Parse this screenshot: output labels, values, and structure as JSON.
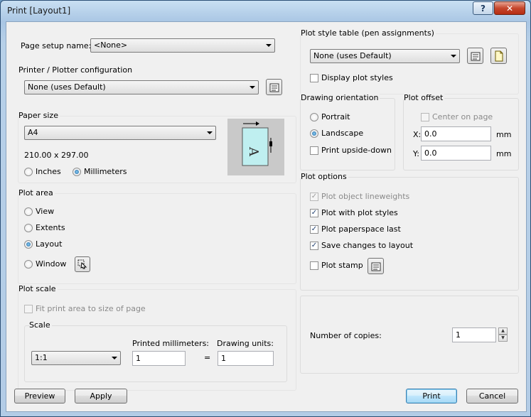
{
  "window": {
    "title": "Print [Layout1]",
    "help_label": "?",
    "close_label": "✕"
  },
  "page_setup": {
    "label": "Page setup name:",
    "value": "<None>"
  },
  "printer": {
    "group_title": "Printer / Plotter configuration",
    "value": "None (uses Default)"
  },
  "paper": {
    "group_title": "Paper size",
    "value": "A4",
    "dimensions": "210.00 x 297.00",
    "units": [
      "Inches",
      "Millimeters"
    ],
    "selected_unit": "Millimeters"
  },
  "plot_area": {
    "group_title": "Plot area",
    "options": [
      "View",
      "Extents",
      "Layout",
      "Window"
    ],
    "selected": "Layout"
  },
  "plot_scale": {
    "group_title": "Plot scale",
    "fit_label": "Fit print area to size of page",
    "scale_group_title": "Scale",
    "scale_value": "1:1",
    "printed_label": "Printed millimeters:",
    "printed_value": "1",
    "equals": "=",
    "drawing_label": "Drawing units:",
    "drawing_value": "1"
  },
  "plot_style": {
    "group_title": "Plot style table (pen assignments)",
    "value": "None (uses Default)",
    "display_label": "Display plot styles"
  },
  "orientation": {
    "group_title": "Drawing orientation",
    "options": [
      "Portrait",
      "Landscape"
    ],
    "selected": "Landscape",
    "upside_down_label": "Print upside-down"
  },
  "plot_offset": {
    "group_title": "Plot offset",
    "center_label": "Center on page",
    "x_label": "X:",
    "x_value": "0.0",
    "y_label": "Y:",
    "y_value": "0.0",
    "unit": "mm"
  },
  "plot_options": {
    "group_title": "Plot options",
    "items": [
      {
        "label": "Plot object lineweights",
        "checked": true,
        "enabled": false
      },
      {
        "label": "Plot with plot styles",
        "checked": true,
        "enabled": true
      },
      {
        "label": "Plot paperspace last",
        "checked": true,
        "enabled": true
      },
      {
        "label": "Save changes to layout",
        "checked": true,
        "enabled": true
      },
      {
        "label": "Plot stamp",
        "checked": false,
        "enabled": true
      }
    ]
  },
  "copies": {
    "label": "Number of copies:",
    "value": "1"
  },
  "footer": {
    "preview": "Preview",
    "apply": "Apply",
    "print": "Print",
    "cancel": "Cancel"
  }
}
